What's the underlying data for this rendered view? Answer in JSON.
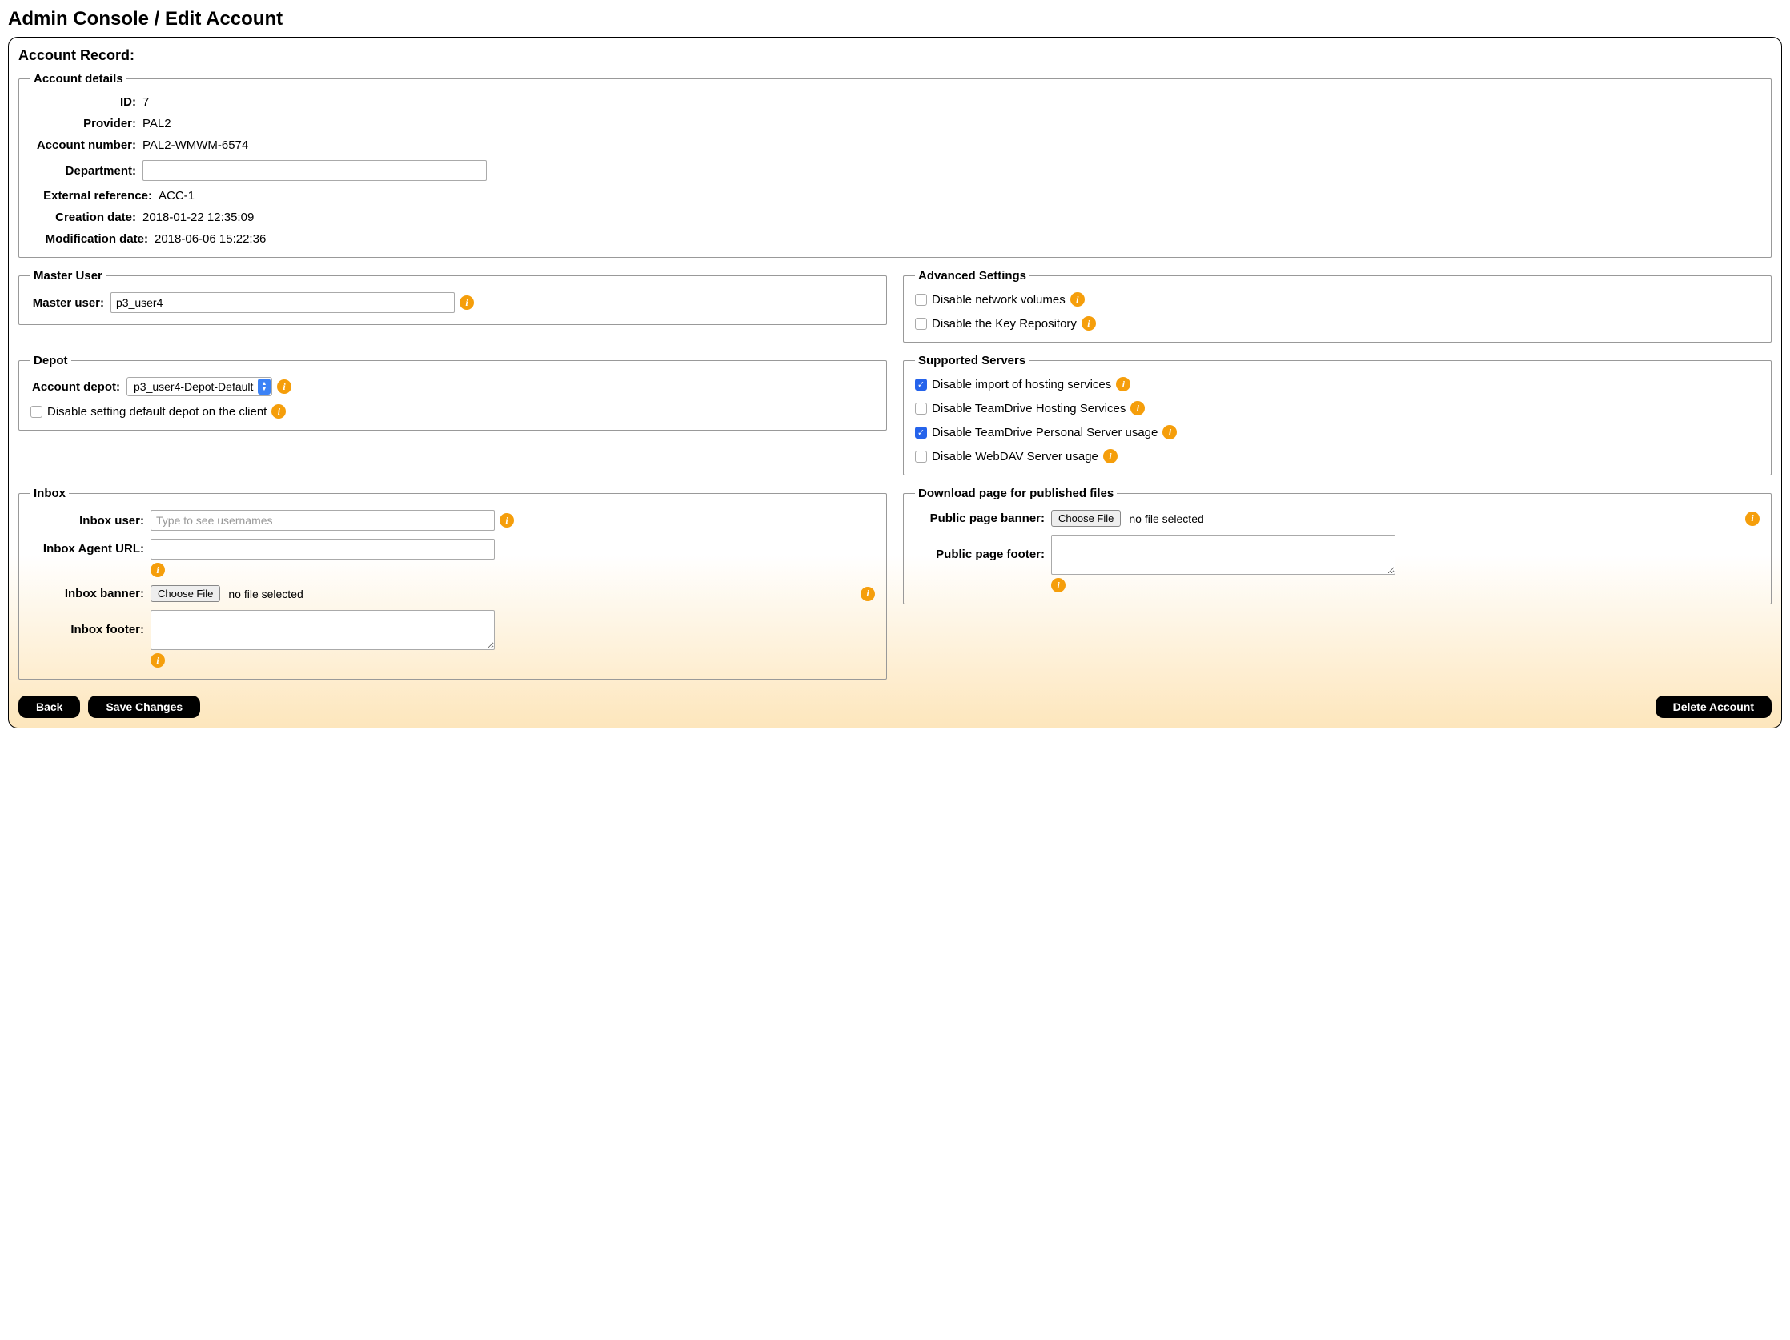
{
  "page_title": "Admin Console / Edit Account",
  "panel_title": "Account Record:",
  "account_details": {
    "legend": "Account details",
    "id_label": "ID:",
    "id_value": "7",
    "provider_label": "Provider:",
    "provider_value": "PAL2",
    "account_number_label": "Account number:",
    "account_number_value": "PAL2-WMWM-6574",
    "department_label": "Department:",
    "department_value": "",
    "ext_ref_label": "External reference:",
    "ext_ref_value": "ACC-1",
    "creation_label": "Creation date:",
    "creation_value": "2018-01-22 12:35:09",
    "modification_label": "Modification date:",
    "modification_value": "2018-06-06 15:22:36"
  },
  "master_user": {
    "legend": "Master User",
    "label": "Master user:",
    "value": "p3_user4"
  },
  "advanced": {
    "legend": "Advanced Settings",
    "disable_network_volumes": "Disable network volumes",
    "disable_key_repo": "Disable the Key Repository"
  },
  "depot": {
    "legend": "Depot",
    "account_depot_label": "Account depot:",
    "account_depot_selected": "p3_user4-Depot-Default",
    "disable_default_depot": "Disable setting default depot on the client"
  },
  "supported": {
    "legend": "Supported Servers",
    "disable_import_hosting": "Disable import of hosting services",
    "disable_td_hosting": "Disable TeamDrive Hosting Services",
    "disable_td_personal": "Disable TeamDrive Personal Server usage",
    "disable_webdav": "Disable WebDAV Server usage"
  },
  "inbox": {
    "legend": "Inbox",
    "user_label": "Inbox user:",
    "user_placeholder": "Type to see usernames",
    "agent_url_label": "Inbox Agent URL:",
    "agent_url_value": "",
    "banner_label": "Inbox banner:",
    "footer_label": "Inbox footer:",
    "footer_value": ""
  },
  "download": {
    "legend": "Download page for published files",
    "banner_label": "Public page banner:",
    "footer_label": "Public page footer:",
    "footer_value": ""
  },
  "file": {
    "choose": "Choose File",
    "none": "no file selected"
  },
  "buttons": {
    "back": "Back",
    "save": "Save Changes",
    "delete": "Delete Account"
  },
  "info_glyph": "i"
}
